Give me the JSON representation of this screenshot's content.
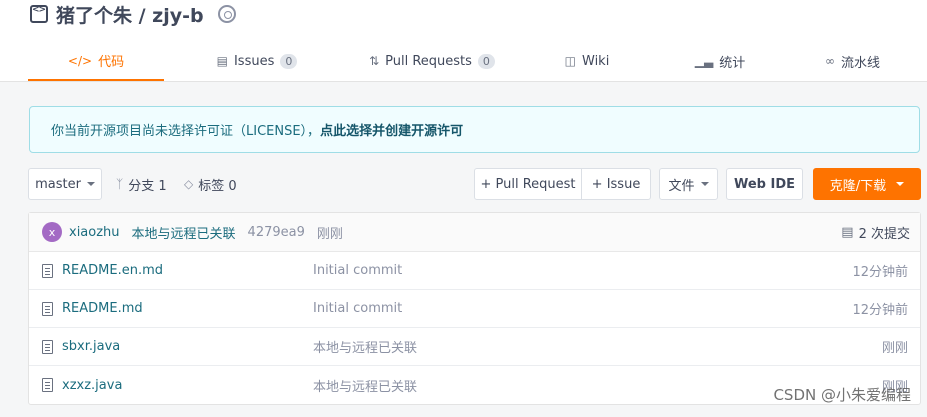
{
  "repo": {
    "title": "猪了个朱 / zjy-b"
  },
  "tabs": [
    {
      "label": "代码",
      "icon": "code-icon",
      "count": null,
      "active": true
    },
    {
      "label": "Issues",
      "icon": "issues-icon",
      "count": "0",
      "active": false
    },
    {
      "label": "Pull Requests",
      "icon": "pull-request-icon",
      "count": "0",
      "active": false
    },
    {
      "label": "Wiki",
      "icon": "wiki-icon",
      "count": null,
      "active": false
    },
    {
      "label": "统计",
      "icon": "stats-icon",
      "count": null,
      "active": false
    },
    {
      "label": "流水线",
      "icon": "pipeline-icon",
      "count": null,
      "active": false
    }
  ],
  "license": {
    "notice": "你当前开源项目尚未选择许可证（LICENSE），",
    "link": "点此选择并创建开源许可"
  },
  "toolbar": {
    "branch": "master",
    "branches": "分支 1",
    "tags": "标签 0",
    "new_pr": "+ Pull Request",
    "new_issue": "+ Issue",
    "files_menu": "文件",
    "web_ide": "Web IDE",
    "clone": "克隆/下载"
  },
  "commit": {
    "avatar_letter": "x",
    "author": "xiaozhu",
    "message": "本地与远程已关联",
    "sha": "4279ea9",
    "time": "刚刚",
    "count": "2 次提交"
  },
  "files": [
    {
      "name": "README.en.md",
      "message": "Initial commit",
      "time": "12分钟前"
    },
    {
      "name": "README.md",
      "message": "Initial commit",
      "time": "12分钟前"
    },
    {
      "name": "sbxr.java",
      "message": "本地与远程已关联",
      "time": "刚刚"
    },
    {
      "name": "xzxz.java",
      "message": "本地与远程已关联",
      "time": "刚刚"
    }
  ],
  "watermark": "CSDN @小朱爱编程",
  "colors": {
    "accent": "#fe7300",
    "link": "#1b6c7e",
    "license_bg": "#f0fdff"
  }
}
